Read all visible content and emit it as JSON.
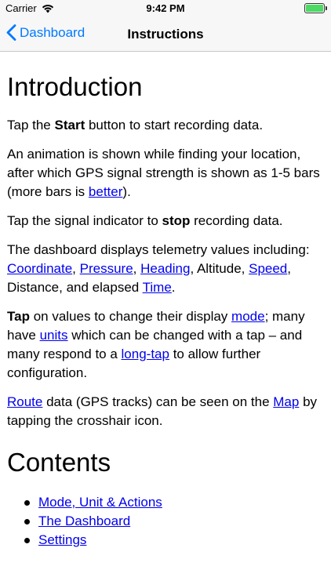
{
  "status": {
    "carrier": "Carrier",
    "time": "9:42 PM",
    "battery_level": 1.0
  },
  "nav": {
    "back_label": "Dashboard",
    "title": "Instructions"
  },
  "intro": {
    "heading": "Introduction",
    "p1": {
      "a": "Tap the ",
      "b": "Start",
      "c": " button to start recording data."
    },
    "p2": {
      "a": "An animation is shown while finding your location, after which GPS signal strength is shown as 1-5 bars (more bars is ",
      "link": "better",
      "c": ")."
    },
    "p3": {
      "a": "Tap the signal indicator to ",
      "b": "stop",
      "c": " recording data."
    },
    "p4": {
      "a": "The dashboard displays telemetry values including: ",
      "l1": "Coordinate",
      "s1": ", ",
      "l2": "Pressure",
      "s2": ", ",
      "l3": "Heading",
      "s3": ", Altitude, ",
      "l4": "Speed",
      "s4": ", Distance, and elapsed ",
      "l5": "Time",
      "s5": "."
    },
    "p5": {
      "b": "Tap",
      "a": " on values to change their display ",
      "l1": "mode",
      "s1": "; many have ",
      "l2": "units",
      "s2": " which can be changed with a tap – and many respond to a ",
      "l3": "long-tap",
      "s3": " to allow further configuration."
    },
    "p6": {
      "l1": "Route",
      "a": " data (GPS tracks) can be seen on the ",
      "l2": "Map",
      "c": " by tapping the crosshair icon."
    }
  },
  "contents": {
    "heading": "Contents",
    "items": [
      "Mode, Unit & Actions",
      "The Dashboard",
      "Settings"
    ]
  }
}
